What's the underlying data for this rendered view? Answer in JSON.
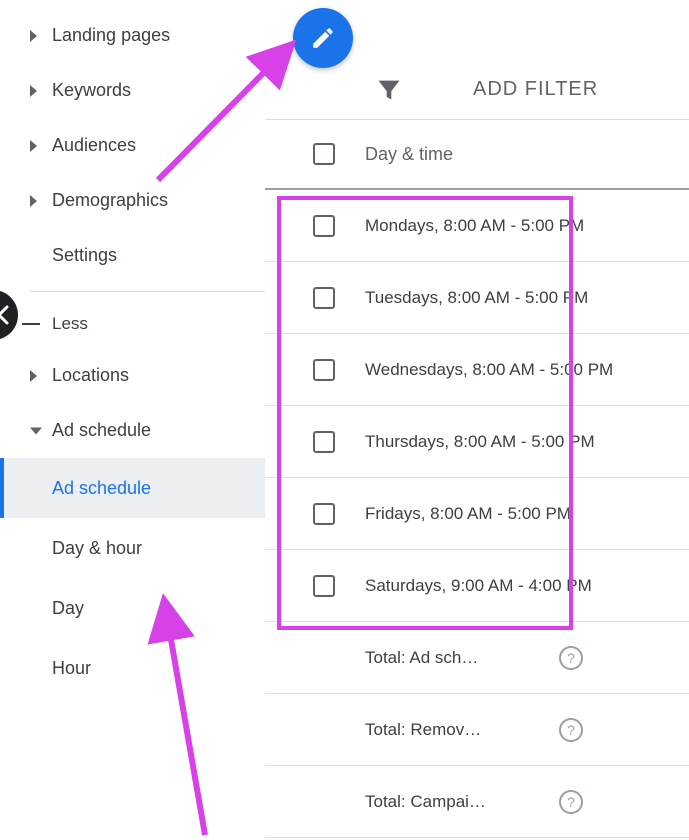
{
  "sidebar": {
    "items": [
      {
        "label": "Landing pages",
        "caret": true
      },
      {
        "label": "Keywords",
        "caret": true
      },
      {
        "label": "Audiences",
        "caret": true
      },
      {
        "label": "Demographics",
        "caret": true
      },
      {
        "label": "Settings",
        "caret": false
      }
    ],
    "less_label": "Less",
    "more_items": [
      {
        "label": "Locations",
        "caret": true
      },
      {
        "label": "Ad schedule",
        "caret": true,
        "expanded": true
      }
    ],
    "sub_items": [
      {
        "label": "Ad schedule",
        "active": true
      },
      {
        "label": "Day & hour"
      },
      {
        "label": "Day"
      },
      {
        "label": "Hour"
      }
    ]
  },
  "filter_label": "ADD FILTER",
  "table": {
    "column_header": "Day & time",
    "rows": [
      {
        "label": "Mondays, 8:00 AM - 5:00 PM"
      },
      {
        "label": "Tuesdays, 8:00 AM - 5:00 PM"
      },
      {
        "label": "Wednesdays, 8:00 AM - 5:00 PM"
      },
      {
        "label": "Thursdays, 8:00 AM - 5:00 PM"
      },
      {
        "label": "Fridays, 8:00 AM - 5:00 PM"
      },
      {
        "label": "Saturdays, 9:00 AM - 4:00 PM"
      }
    ],
    "totals": [
      {
        "label": "Total: Ad sch…"
      },
      {
        "label": "Total: Remov…"
      },
      {
        "label": "Total: Campai…"
      }
    ]
  },
  "annotations": {
    "highlight_color": "#d642e8"
  }
}
